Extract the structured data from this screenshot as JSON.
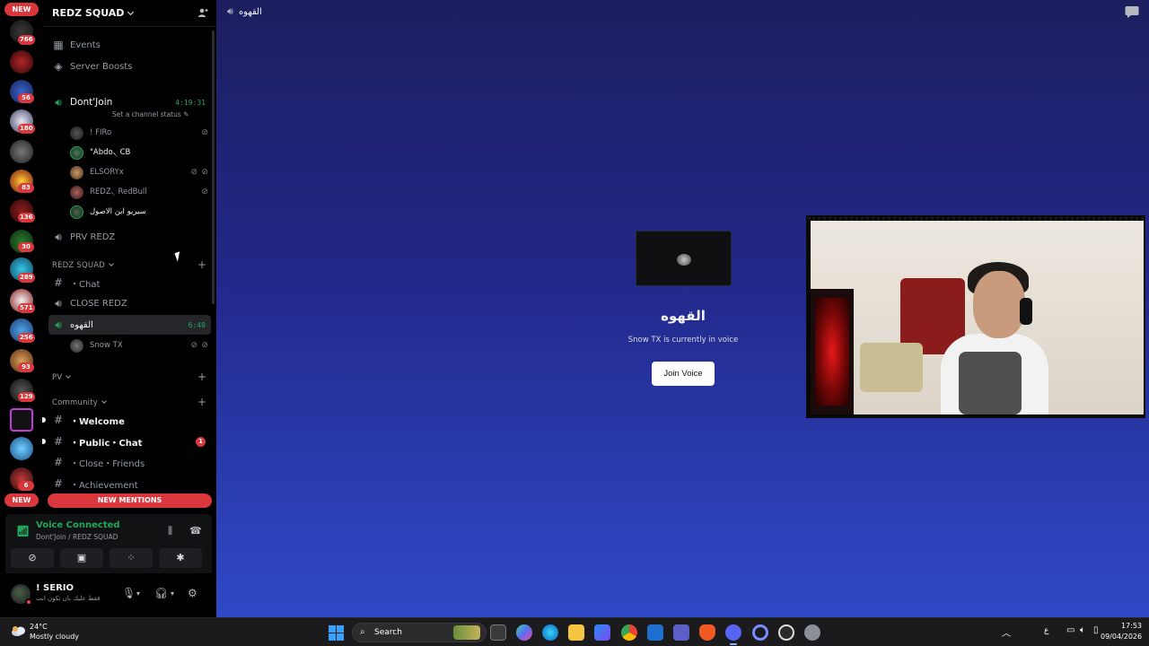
{
  "server_rail": {
    "new_top": "NEW",
    "new_bottom": "NEW",
    "badges": [
      "766",
      "56",
      "180",
      "83",
      "136",
      "30",
      "289",
      "571",
      "256",
      "93",
      "129",
      "6"
    ]
  },
  "sidebar": {
    "server_name": "REDZ SQUAD",
    "events": "Events",
    "server_boosts": "Server Boosts",
    "voice_channel_1": {
      "name": "Dont'Join",
      "timer": "4:19:31",
      "status_prompt": "Set a channel status",
      "members": [
        "! FIRo",
        "\"Abdo৲ CB",
        "ELSORYx",
        "REDZ৲ RedBull",
        "سيريو ابن الاصول"
      ]
    },
    "prv_redz": "PRV REDZ",
    "category_redz": "REDZ SQUAD",
    "chat": "・Chat",
    "close_redz": "CLOSE REDZ",
    "voice_channel_2": {
      "name": "القهوه",
      "timer": "6:40",
      "members": [
        "Snow TX"
      ]
    },
    "category_pv": "PV",
    "category_community": "Community",
    "welcome": "・Welcome",
    "public_chat": "・Public・Chat",
    "public_chat_badge": "1",
    "close_friends": "・Close・Friends",
    "achievement": "・Achievement",
    "new_mentions": "NEW MENTIONS"
  },
  "voice_panel": {
    "status": "Voice Connected",
    "sub": "Dont'Join / REDZ SQUAD"
  },
  "user_panel": {
    "name": "! SERIO",
    "sub": "فقط عليك بان تكون انت"
  },
  "main": {
    "header_title": "القهوه",
    "channel_title": "القهوه",
    "channel_desc": "Snow TX is currently in voice",
    "join_button": "Join Voice"
  },
  "taskbar": {
    "temp": "24°C",
    "weather": "Mostly cloudy",
    "search_label": "Search",
    "lang": "ع",
    "time": "17:53",
    "date": "09/04/2026"
  },
  "colors": {
    "accent_green": "#23a55a",
    "danger_red": "#da373c",
    "main_bg_top": "#1d1e5e",
    "main_bg_bottom": "#2f49c7"
  }
}
